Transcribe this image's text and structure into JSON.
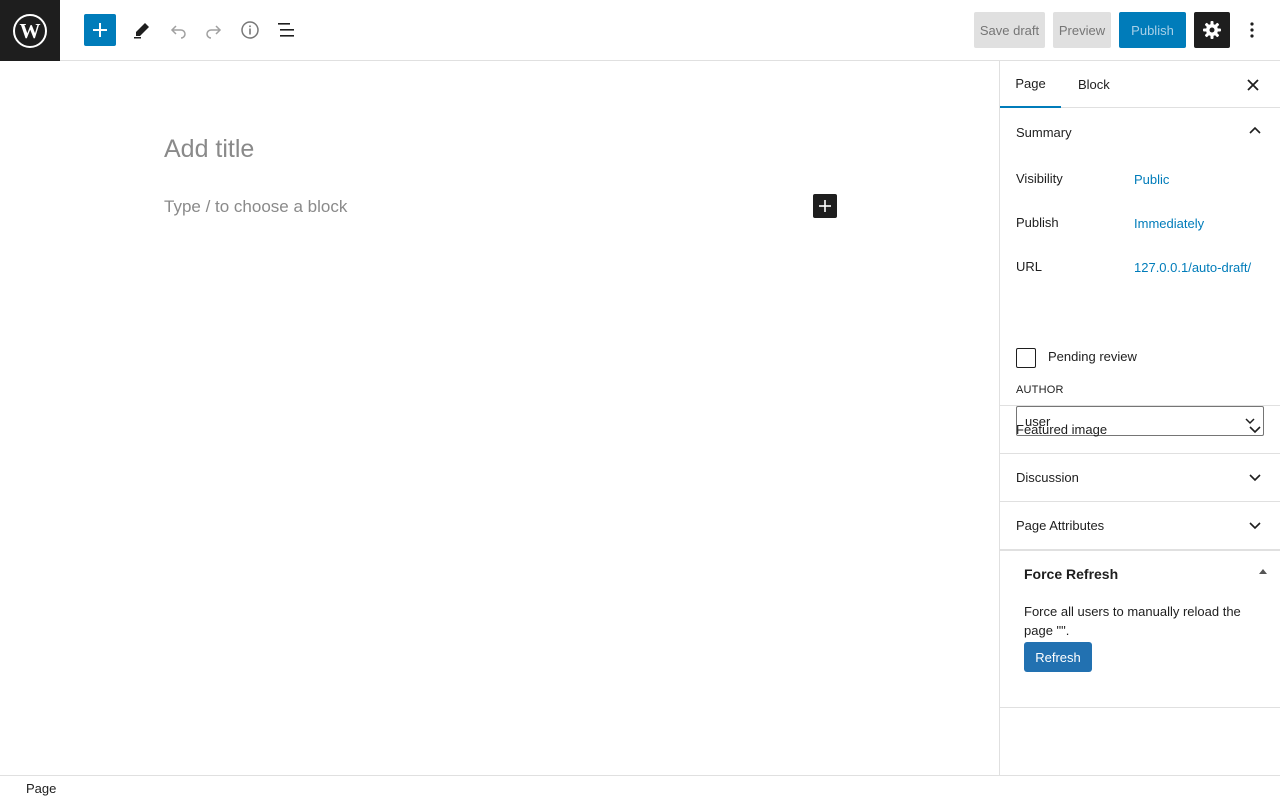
{
  "toolbar": {
    "logo_icon": "wordpress-logo",
    "add_block_icon": "plus-icon",
    "tools_icon": "pencil-icon",
    "undo_icon": "undo-icon",
    "redo_icon": "redo-icon",
    "details_icon": "info-icon",
    "list_view_icon": "list-view-icon",
    "save_draft": "Save draft",
    "preview": "Preview",
    "publish": "Publish",
    "settings_icon": "gear-icon",
    "more_icon": "more-vertical-icon"
  },
  "editor": {
    "title_placeholder": "Add title",
    "block_placeholder": "Type / to choose a block"
  },
  "sidebar": {
    "tabs": [
      {
        "label": "Page",
        "active": true
      },
      {
        "label": "Block",
        "active": false
      }
    ],
    "summary": {
      "title": "Summary",
      "rows": [
        {
          "label": "Visibility",
          "value": "Public"
        },
        {
          "label": "Publish",
          "value": "Immediately"
        },
        {
          "label": "URL",
          "value": "127.0.0.1/auto-draft/"
        }
      ],
      "pending_review_label": "Pending review",
      "pending_review_checked": false,
      "author_label": "AUTHOR",
      "author_value": "user"
    },
    "panels": [
      {
        "label": "Featured image"
      },
      {
        "label": "Discussion"
      },
      {
        "label": "Page Attributes"
      }
    ],
    "force_refresh": {
      "title": "Force Refresh",
      "description": "Force all users to manually reload the page \"\".",
      "button": "Refresh"
    }
  },
  "footer": {
    "breadcrumb": "Page"
  },
  "colors": {
    "accent": "#007cba",
    "dark": "#1e1e1e",
    "refresh_button": "#2271b1"
  }
}
